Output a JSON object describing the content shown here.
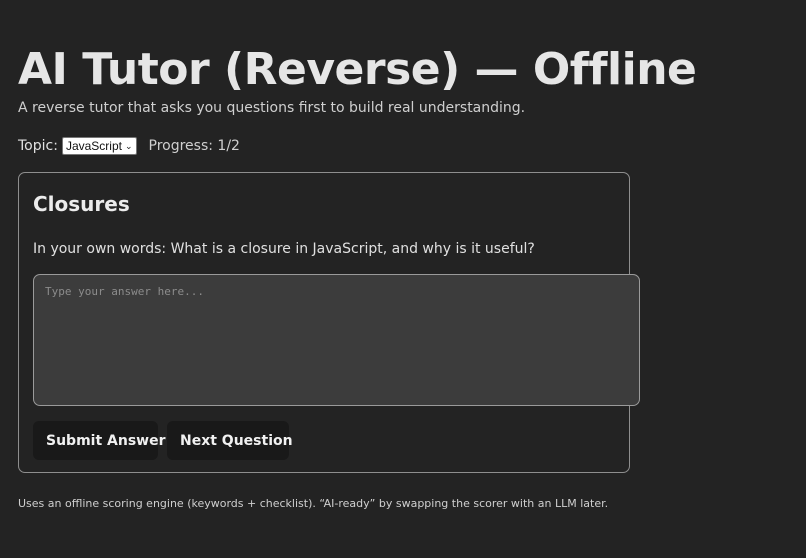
{
  "header": {
    "title": "AI Tutor (Reverse) — Offline",
    "subtitle": "A reverse tutor that asks you questions first to build real understanding."
  },
  "controls": {
    "topic_label": "Topic:",
    "topic_selected": "JavaScript",
    "progress_text": "Progress: 1/2"
  },
  "card": {
    "title": "Closures",
    "question": "In your own words: What is a closure in JavaScript, and why is it useful?",
    "answer_placeholder": "Type your answer here...",
    "answer_value": "",
    "submit_label": "Submit Answer",
    "next_label": "Next Question"
  },
  "footer": {
    "note": "Uses an offline scoring engine (keywords + checklist). “AI-ready” by swapping the scorer with an LLM later."
  }
}
